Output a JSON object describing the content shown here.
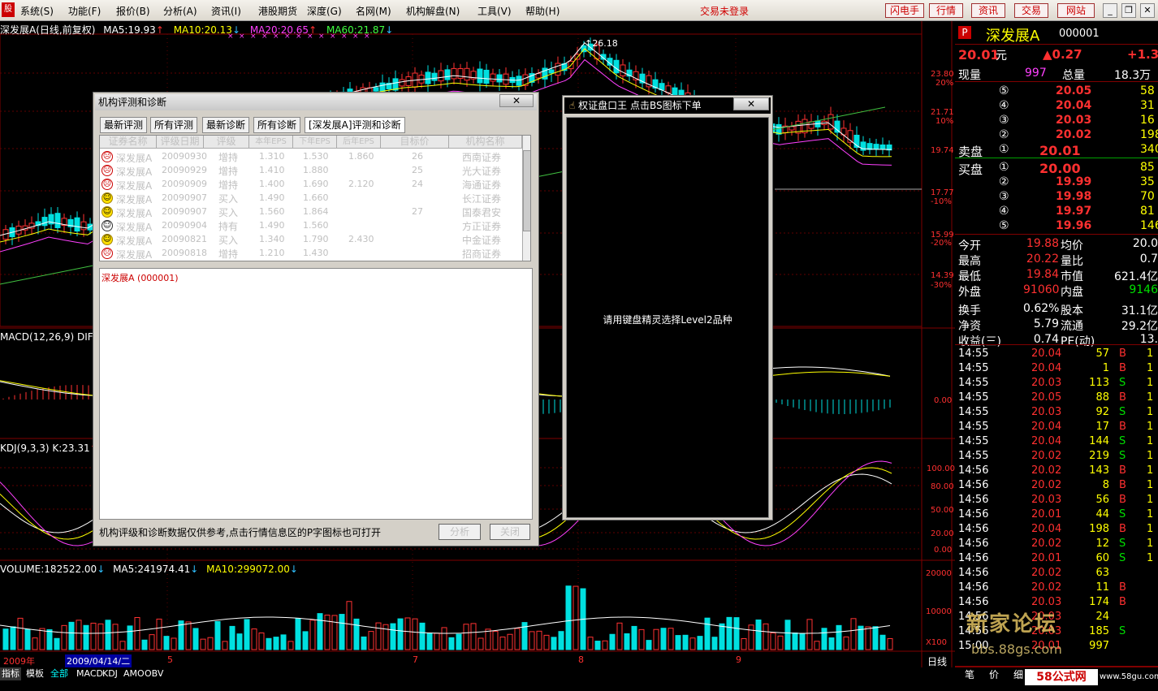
{
  "menu": {
    "logo": "股",
    "items": [
      "系统(S)",
      "功能(F)",
      "报价(B)",
      "分析(A)",
      "资讯(I)",
      "港股期货",
      "深度(G)",
      "名网(M)",
      "机构解盘(N)",
      "工具(V)",
      "帮助(H)"
    ],
    "login_status": "交易未登录",
    "toolbar": [
      "闪电手",
      "行情",
      "资讯",
      "交易",
      "网站"
    ]
  },
  "chart": {
    "title": "深发展A(日线,前复权)",
    "ma5": "MA5:19.93",
    "ma10": "MA10:20.13",
    "ma20": "MA20:20.65",
    "ma60": "MA60:21.87",
    "peak_label": "26.18",
    "price_ticks": [
      "23.80",
      "21.71",
      "19.74",
      "17.77",
      "15.99",
      "14.39"
    ],
    "pct_ticks": [
      "20%",
      "10%",
      "",
      "-10%",
      "-20%",
      "-30%"
    ],
    "macd_label": "MACD(12,26,9) DIF:",
    "macd_zero": "0.00",
    "kdj_label": "KDJ(9,3,3) K:23.31",
    "kdj_ticks": [
      "100.00",
      "80.00",
      "50.00",
      "20.00",
      "0.00"
    ],
    "volume_label": "VOLUME:182522.00",
    "vol_ma5": "MA5:241974.41",
    "vol_ma10": "MA10:299072.00",
    "vol_ticks": [
      "20000",
      "10000",
      "X100"
    ],
    "dates": [
      "2009年",
      "2009/04/14/二",
      "5",
      "7",
      "8",
      "9"
    ],
    "period": "日线"
  },
  "bottom_tabs": [
    "指标",
    "模板",
    "全部",
    "MACD",
    "KDJ",
    "AMO",
    "OBV"
  ],
  "quote": {
    "flag": "P",
    "name": "深发展A",
    "code": "000001",
    "price": "20.01",
    "unit": "元",
    "change": "▲0.27",
    "change_pct": "+1.3",
    "now_vol_label": "现量",
    "now_vol": "997",
    "total_label": "总量",
    "total": "18.3万",
    "sell_label": "卖盘",
    "buy_label": "买盘",
    "asks": [
      {
        "lvl": "⑤",
        "price": "20.05",
        "vol": "58"
      },
      {
        "lvl": "④",
        "price": "20.04",
        "vol": "31"
      },
      {
        "lvl": "③",
        "price": "20.03",
        "vol": "16"
      },
      {
        "lvl": "②",
        "price": "20.02",
        "vol": "198"
      },
      {
        "lvl": "①",
        "price": "20.01",
        "vol": "340"
      }
    ],
    "bids": [
      {
        "lvl": "①",
        "price": "20.00",
        "vol": "85"
      },
      {
        "lvl": "②",
        "price": "19.99",
        "vol": "35"
      },
      {
        "lvl": "③",
        "price": "19.98",
        "vol": "70"
      },
      {
        "lvl": "④",
        "price": "19.97",
        "vol": "81"
      },
      {
        "lvl": "⑤",
        "price": "19.96",
        "vol": "146"
      }
    ],
    "stats": [
      {
        "l1": "今开",
        "v1": "19.88",
        "l2": "均价",
        "v2": "20.0"
      },
      {
        "l1": "最高",
        "v1": "20.22",
        "l2": "量比",
        "v2": "0.7"
      },
      {
        "l1": "最低",
        "v1": "19.84",
        "l2": "市值",
        "v2": "621.4亿"
      },
      {
        "l1": "外盘",
        "v1": "91060",
        "l2": "内盘",
        "v2": "9146"
      },
      {
        "l1": "换手",
        "v1": "0.62%",
        "l2": "股本",
        "v2": "31.1亿"
      },
      {
        "l1": "净资",
        "v1": "5.79",
        "l2": "流通",
        "v2": "29.2亿"
      },
      {
        "l1": "收益(三)",
        "v1": "0.74",
        "l2": "PE(动)",
        "v2": "13."
      }
    ],
    "ticks": [
      {
        "t": "14:55",
        "p": "20.04",
        "v": "57",
        "s": "B",
        "n": "1"
      },
      {
        "t": "14:55",
        "p": "20.04",
        "v": "1",
        "s": "B",
        "n": "1"
      },
      {
        "t": "14:55",
        "p": "20.03",
        "v": "113",
        "s": "S",
        "n": "1"
      },
      {
        "t": "14:55",
        "p": "20.05",
        "v": "88",
        "s": "B",
        "n": "1"
      },
      {
        "t": "14:55",
        "p": "20.03",
        "v": "92",
        "s": "S",
        "n": "1"
      },
      {
        "t": "14:55",
        "p": "20.04",
        "v": "17",
        "s": "B",
        "n": "1"
      },
      {
        "t": "14:55",
        "p": "20.04",
        "v": "144",
        "s": "S",
        "n": "1"
      },
      {
        "t": "14:55",
        "p": "20.02",
        "v": "219",
        "s": "S",
        "n": "1"
      },
      {
        "t": "14:56",
        "p": "20.02",
        "v": "143",
        "s": "B",
        "n": "1"
      },
      {
        "t": "14:56",
        "p": "20.02",
        "v": "8",
        "s": "B",
        "n": "1"
      },
      {
        "t": "14:56",
        "p": "20.03",
        "v": "56",
        "s": "B",
        "n": "1"
      },
      {
        "t": "14:56",
        "p": "20.01",
        "v": "44",
        "s": "S",
        "n": "1"
      },
      {
        "t": "14:56",
        "p": "20.04",
        "v": "198",
        "s": "B",
        "n": "1"
      },
      {
        "t": "14:56",
        "p": "20.02",
        "v": "12",
        "s": "S",
        "n": "1"
      },
      {
        "t": "14:56",
        "p": "20.01",
        "v": "60",
        "s": "S",
        "n": "1"
      },
      {
        "t": "14:56",
        "p": "20.02",
        "v": "63",
        "s": "",
        "n": ""
      },
      {
        "t": "14:56",
        "p": "20.02",
        "v": "11",
        "s": "B",
        "n": ""
      },
      {
        "t": "14:56",
        "p": "20.03",
        "v": "174",
        "s": "B",
        "n": ""
      },
      {
        "t": "14:56",
        "p": "20.03",
        "v": "24",
        "s": "",
        "n": ""
      },
      {
        "t": "14:56",
        "p": "20.03",
        "v": "185",
        "s": "S",
        "n": ""
      },
      {
        "t": "15:00",
        "p": "20.01",
        "v": "997",
        "s": "",
        "n": ""
      }
    ],
    "bottom_tabs": [
      "笔",
      "价",
      "细"
    ]
  },
  "dialog": {
    "title": "机构评测和诊断",
    "close": "✕",
    "tabs": [
      "最新评测",
      "所有评测",
      "最新诊断",
      "所有诊断",
      "[深发展A]评测和诊断"
    ],
    "columns": [
      "证券名称",
      "评级日期",
      "评级",
      "本年EPS",
      "下年EPS",
      "后年EPS",
      "目标价",
      "机构名称"
    ],
    "rows": [
      {
        "mood": "sad",
        "name": "深发展A",
        "date": "20090930",
        "rating": "增持",
        "eps1": "1.310",
        "eps2": "1.530",
        "eps3": "1.860",
        "target": "26",
        "org": "西南证券"
      },
      {
        "mood": "sad",
        "name": "深发展A",
        "date": "20090929",
        "rating": "增持",
        "eps1": "1.410",
        "eps2": "1.880",
        "eps3": "",
        "target": "25",
        "org": "光大证券"
      },
      {
        "mood": "sad",
        "name": "深发展A",
        "date": "20090909",
        "rating": "增持",
        "eps1": "1.400",
        "eps2": "1.690",
        "eps3": "2.120",
        "target": "24",
        "org": "海通证券"
      },
      {
        "mood": "happy",
        "name": "深发展A",
        "date": "20090907",
        "rating": "买入",
        "eps1": "1.490",
        "eps2": "1.660",
        "eps3": "",
        "target": "",
        "org": "长江证券"
      },
      {
        "mood": "happy",
        "name": "深发展A",
        "date": "20090907",
        "rating": "买入",
        "eps1": "1.560",
        "eps2": "1.864",
        "eps3": "",
        "target": "27",
        "org": "国泰君安"
      },
      {
        "mood": "neutral",
        "name": "深发展A",
        "date": "20090904",
        "rating": "持有",
        "eps1": "1.490",
        "eps2": "1.560",
        "eps3": "",
        "target": "",
        "org": "方正证券"
      },
      {
        "mood": "happy",
        "name": "深发展A",
        "date": "20090821",
        "rating": "买入",
        "eps1": "1.340",
        "eps2": "1.790",
        "eps3": "2.430",
        "target": "",
        "org": "中金证券"
      },
      {
        "mood": "sad",
        "name": "深发展A",
        "date": "20090818",
        "rating": "增持",
        "eps1": "1.210",
        "eps2": "1.430",
        "eps3": "",
        "target": "",
        "org": "招商证券"
      }
    ],
    "detail_header": "深发展A (000001)",
    "footer_note": "机构评级和诊断数据仅供参考,点击行情信息区的P字图标也可打开",
    "analyze": "分析",
    "close_btn": "关闭"
  },
  "dialog2": {
    "title": "权证盘口王 点击BS图标下单",
    "close": "✕",
    "message": "请用键盘精灵选择Level2品种"
  },
  "watermark": {
    "line1": "新家论坛",
    "line2": "bbs.88gs.com",
    "badge": "58公式网",
    "url": "www.58gu.com"
  },
  "colors": {
    "up": "#ff3232",
    "down": "#00e0e0",
    "yellow": "#ffff00",
    "bg": "#000000"
  }
}
